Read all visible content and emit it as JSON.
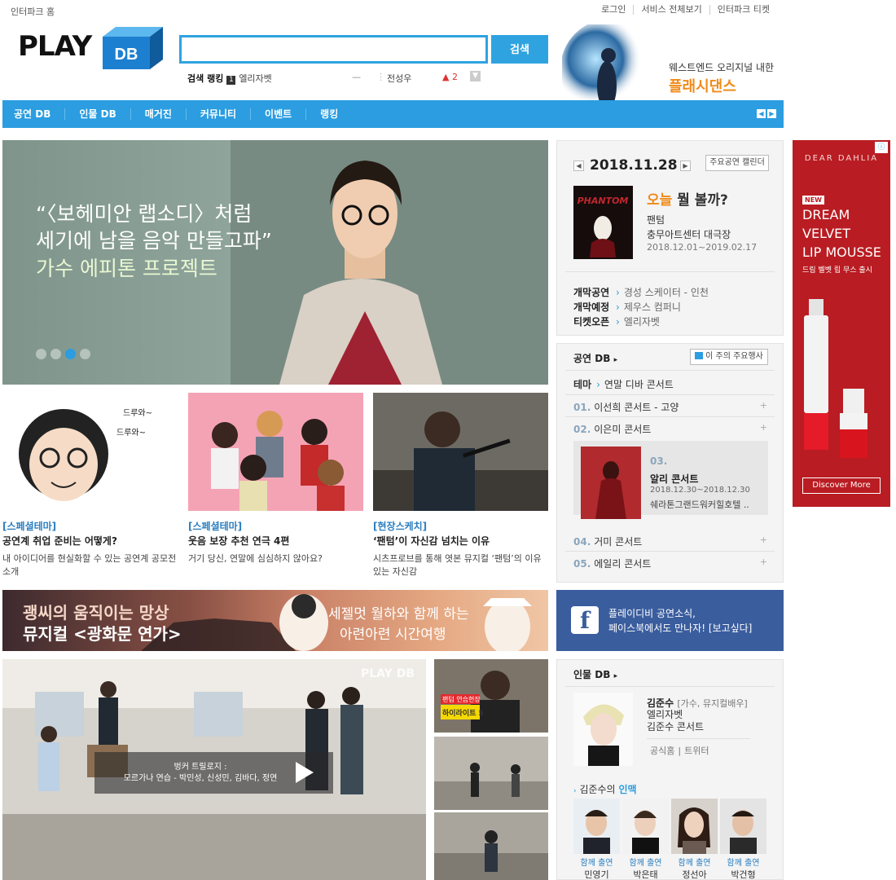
{
  "top": {
    "home_link": "인터파크 홈",
    "links": [
      "로그인",
      "서비스 전체보기",
      "인터파크 티켓"
    ]
  },
  "logo": {
    "text_play": "PLAY",
    "text_db": "DB"
  },
  "search": {
    "button": "검색",
    "rank_label": "검색 랭킹",
    "rank_num": "1",
    "rank_item": "엘리자벳",
    "rank_item2": "전성우",
    "rank_change": "2"
  },
  "top_ad": {
    "line1": "웨스트엔드 오리지널 내한",
    "line2": "플래시댄스"
  },
  "nav": {
    "items": [
      "공연 DB",
      "인물 DB",
      "매거진",
      "커뮤니티",
      "이벤트",
      "랭킹"
    ]
  },
  "hero": {
    "line1": "“〈보헤미안 랩소디〉처럼",
    "line2": "세기에 남을 음악 만들고파”",
    "line3": "가수 에피톤 프로젝트"
  },
  "cards": [
    {
      "category": "[스페셜테마]",
      "title": "공연계 취업 준비는 어떻게?",
      "desc": "내 아이디어를 현실화할 수 있는 공연계 공모전 소개",
      "bubble1": "드루와~",
      "bubble2": "드루와~"
    },
    {
      "category": "[스페셜테마]",
      "title": "웃음 보장 추천 연극 4편",
      "desc": "거기 당신, 연말에 심심하지 않아요?"
    },
    {
      "category": "[현장스케치]",
      "title": "‘팬텀’이 자신감 넘치는 이유",
      "desc": "시츠프로브를 통해 엿본 뮤지컬 ‘팬텀’의 이유 있는 자신감"
    }
  ],
  "banner": {
    "line1": "괭씨의 움직이는 망상",
    "line2": "뮤지컬 <광화문 연가>",
    "line3": "세젤멋 월하와 함께 하는",
    "line4": "아련아련 시간여행"
  },
  "video": {
    "watermark": "PLAY DB",
    "caption1": "벙커 트릴로지 :",
    "caption2": "모르가나 연습 - 박민성, 신성민, 김바다, 정연",
    "thumb_badge1": "팬텀 연습현장",
    "thumb_badge2": "하이라이트 5"
  },
  "today": {
    "date": "2018.11.28",
    "calendar_btn": "주요공연 캘린더",
    "q_highlight": "오늘",
    "q_rest": " 뭘 볼까?",
    "name": "팬텀",
    "venue": "충무아트센터 대극장",
    "period": "2018.12.01~2019.02.17",
    "schedule": [
      {
        "label": "개막공연",
        "value": "경성 스케이터 - 인천"
      },
      {
        "label": "개막예정",
        "value": "제우스 컴퍼니"
      },
      {
        "label": "티켓오픈",
        "value": "엘리자벳"
      }
    ]
  },
  "showdb": {
    "title": "공연 DB",
    "week_btn": "이 주의 주요행사",
    "theme_label": "테마",
    "theme_value": "연말 디바 콘서트",
    "ranks": [
      {
        "num": "01.",
        "name": "이선희 콘서트 - 고양"
      },
      {
        "num": "02.",
        "name": "이은미 콘서트"
      },
      {
        "num": "04.",
        "name": "거미 콘서트"
      },
      {
        "num": "05.",
        "name": "에일리 콘서트"
      }
    ],
    "open": {
      "num": "03.",
      "name": "알리 콘서트",
      "period": "2018.12.30~2018.12.30",
      "venue": "쉐라톤그랜드워커힐호텔 .."
    }
  },
  "facebook": {
    "line1": "플레이디비 공연소식,",
    "line2": "페이스북에서도 만나자! [보고싶다]"
  },
  "person": {
    "title": "인물 DB",
    "name": "김준수",
    "role": "[가수, 뮤지컬배우]",
    "work1": "엘리자벳",
    "work2": "김준수 콘서트",
    "link1": "공식홈",
    "link2": "트위터",
    "conn_name": "김준수의",
    "conn_label": "인맥",
    "connections": [
      {
        "label": "함께 출연",
        "name": "민영기"
      },
      {
        "label": "함께 출연",
        "name": "박은태"
      },
      {
        "label": "함께 출연",
        "name": "정선아"
      },
      {
        "label": "함께 출연",
        "name": "박건형"
      }
    ]
  },
  "side_ad": {
    "brand": "DEAR DAHLIA",
    "badge": "NEW",
    "h1": "DREAM",
    "h2": "VELVET",
    "h3": "LIP MOUSSE",
    "sub": "드림 벨벳 립 무스 출시",
    "cta": "Discover More"
  }
}
